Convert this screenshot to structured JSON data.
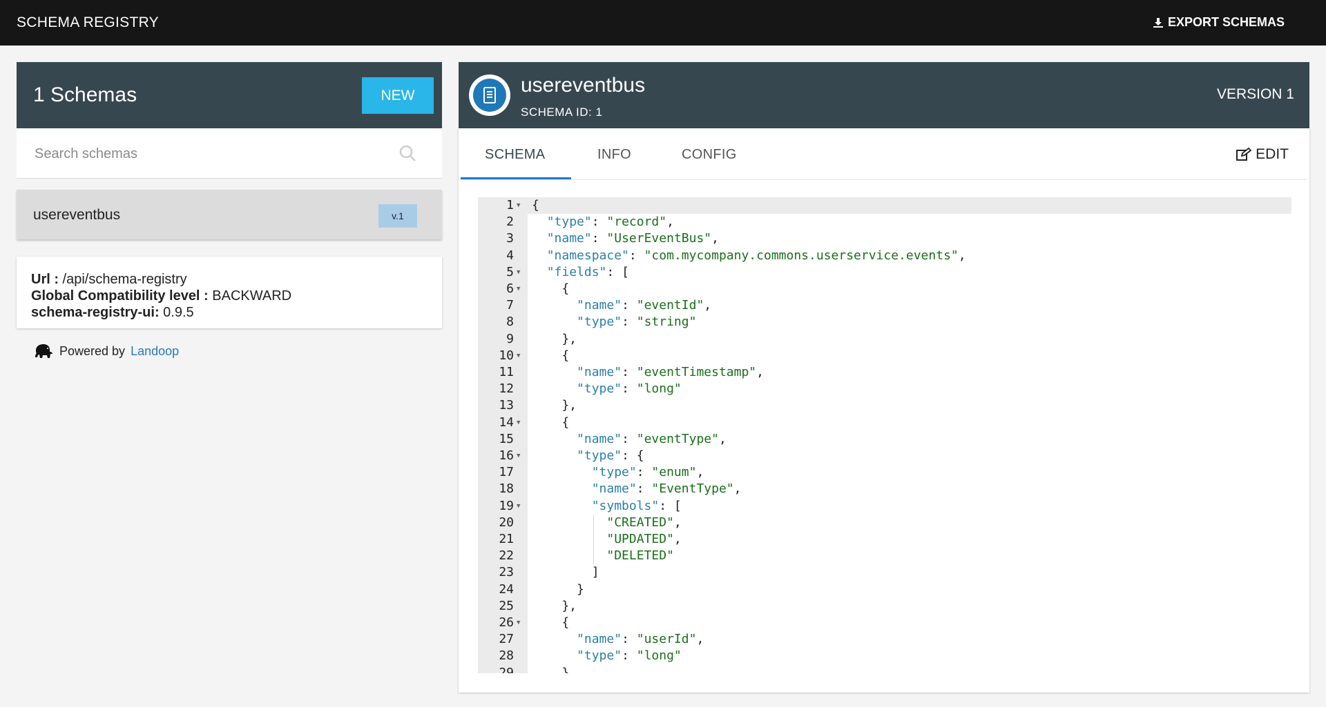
{
  "topbar": {
    "brand": "SCHEMA REGISTRY",
    "export_label": "EXPORT SCHEMAS"
  },
  "sidebar": {
    "count_label": "1 Schemas",
    "new_label": "NEW",
    "search_placeholder": "Search schemas",
    "items": [
      {
        "name": "usereventbus",
        "version": "v.1"
      }
    ]
  },
  "info": {
    "url_label": "Url :",
    "url_value": " /api/schema-registry",
    "compat_label": "Global Compatibility level :",
    "compat_value": " BACKWARD",
    "ui_label": "schema-registry-ui:",
    "ui_value": " 0.9.5"
  },
  "footer": {
    "powered_by": "Powered by",
    "link": "Landoop"
  },
  "schema": {
    "title": "usereventbus",
    "schema_id": "SCHEMA ID: 1",
    "version": "VERSION 1",
    "edit_label": "EDIT",
    "tabs": [
      "SCHEMA",
      "INFO",
      "CONFIG"
    ]
  },
  "colors": {
    "topbar": "#161616",
    "header": "#37474f",
    "accent": "#29b6e8",
    "key": "#2a7fa8",
    "string": "#1a6f1a"
  },
  "code_lines": [
    "{",
    "  \"type\": \"record\",",
    "  \"name\": \"UserEventBus\",",
    "  \"namespace\": \"com.mycompany.commons.userservice.events\",",
    "  \"fields\": [",
    "    {",
    "      \"name\": \"eventId\",",
    "      \"type\": \"string\"",
    "    },",
    "    {",
    "      \"name\": \"eventTimestamp\",",
    "      \"type\": \"long\"",
    "    },",
    "    {",
    "      \"name\": \"eventType\",",
    "      \"type\": {",
    "        \"type\": \"enum\",",
    "        \"name\": \"EventType\",",
    "        \"symbols\": [",
    "          \"CREATED\",",
    "          \"UPDATED\",",
    "          \"DELETED\"",
    "        ]",
    "      }",
    "    },",
    "    {",
    "      \"name\": \"userId\",",
    "      \"type\": \"long\"",
    "    },"
  ],
  "fold_lines": [
    1,
    5,
    6,
    10,
    14,
    16,
    19,
    26
  ]
}
